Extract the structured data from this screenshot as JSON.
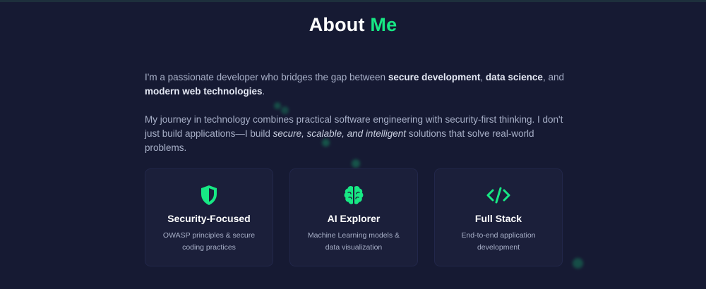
{
  "section": {
    "title_main": "About",
    "title_accent": "Me"
  },
  "intro": {
    "p1": {
      "t1": "I'm a passionate developer who bridges the gap between ",
      "b1": "secure development",
      "t2": ", ",
      "b2": "data science",
      "t3": ", and ",
      "b3": "modern web technologies",
      "t4": "."
    },
    "p2": {
      "t1": "My journey in technology combines practical software engineering with security-first thinking. I don't just build applications—I build ",
      "i1": "secure, scalable, and intelligent",
      "t2": " solutions that solve real-world problems."
    }
  },
  "cards": [
    {
      "icon": "shield-icon",
      "title": "Security-Focused",
      "desc": "OWASP principles & secure coding practices"
    },
    {
      "icon": "brain-icon",
      "title": "AI Explorer",
      "desc": "Machine Learning models & data visualization"
    },
    {
      "icon": "code-icon",
      "title": "Full Stack",
      "desc": "End-to-end application development"
    }
  ],
  "colors": {
    "background": "#161a33",
    "accent": "#17e884",
    "card_background": "#1b1f3a",
    "text_muted": "#a8b0c8"
  }
}
